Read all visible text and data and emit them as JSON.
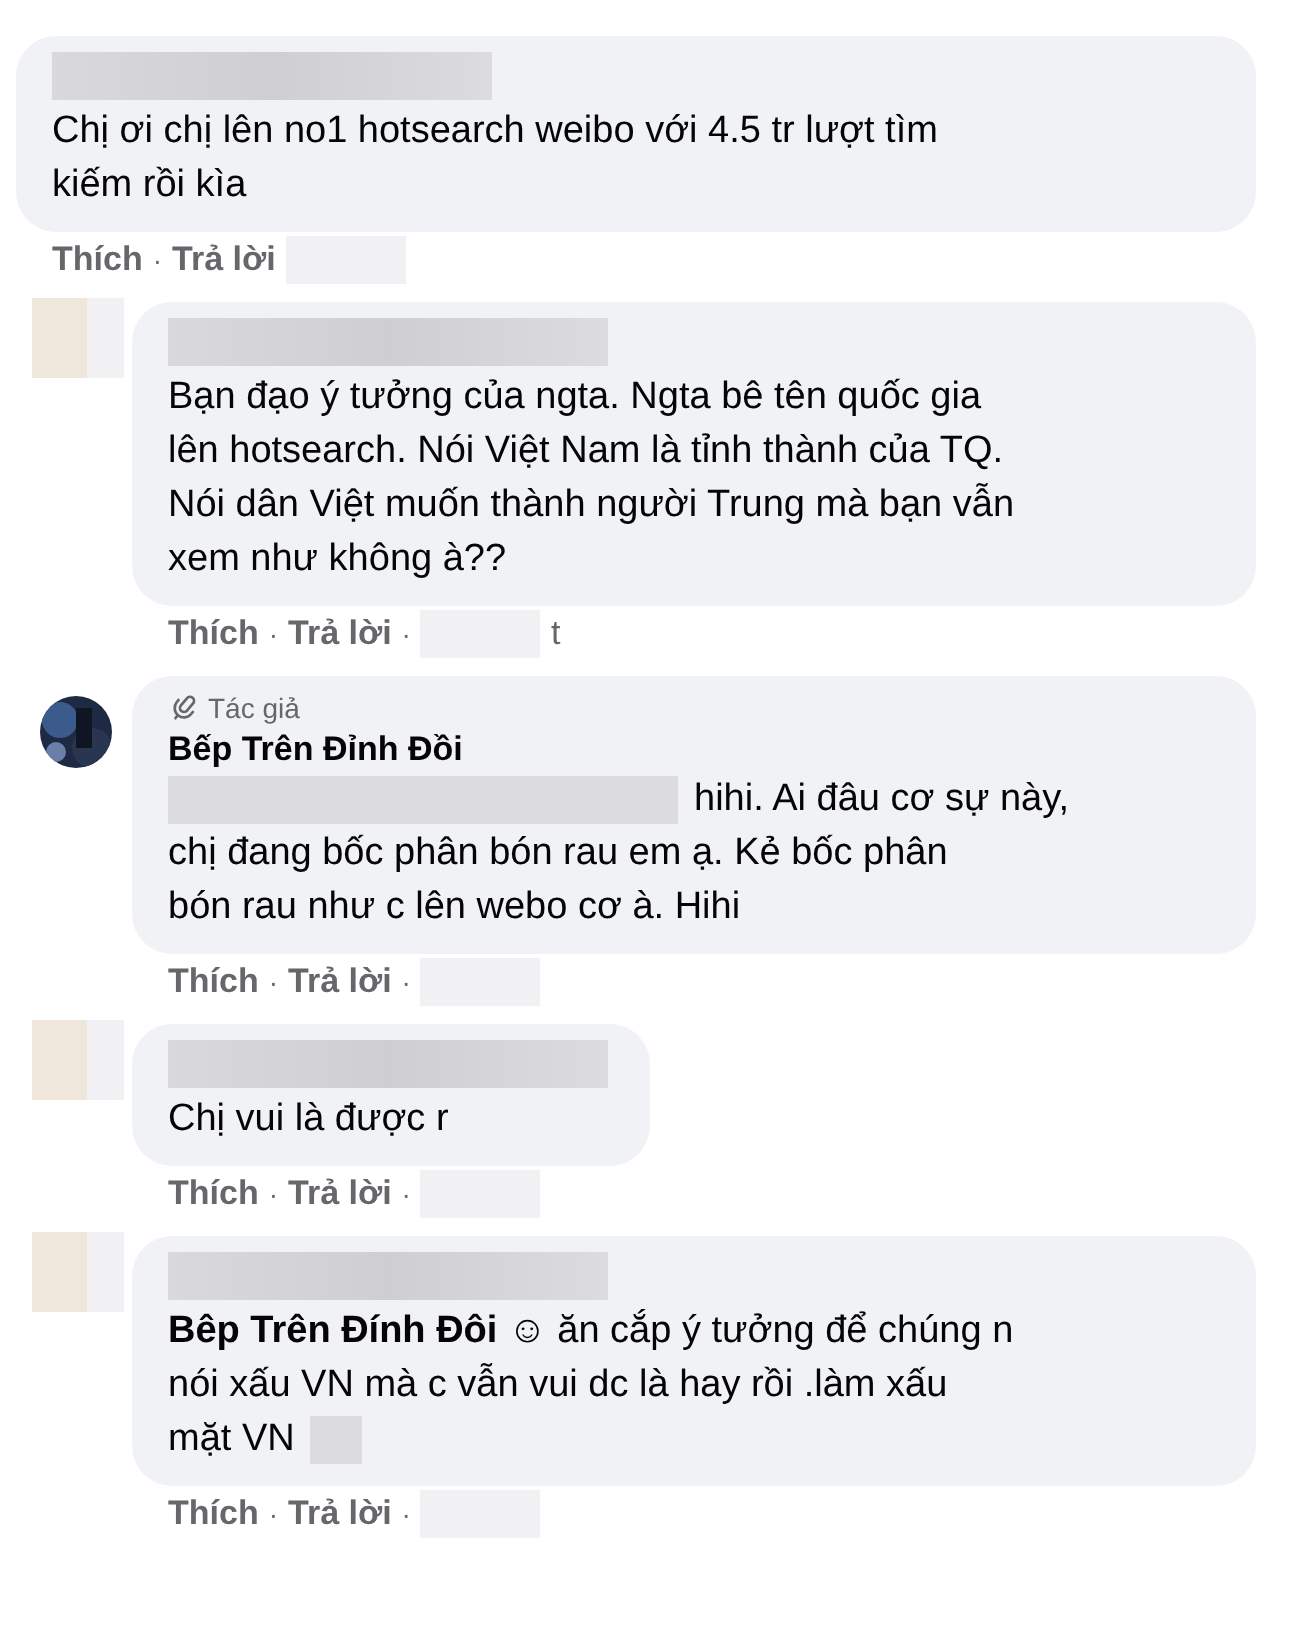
{
  "separator": "·",
  "comments": [
    {
      "kind": "top",
      "lines": [
        "Chị ơi chị lên no1 hotsearch weibo với 4.5 tr lượt tìm",
        "kiếm rồi kìa"
      ],
      "actions": [
        "Thích",
        "Trả lời"
      ]
    },
    {
      "kind": "reply",
      "lines": [
        "Bạn đạo ý tưởng của ngta. Ngta bê tên quốc gia",
        "lên hotsearch. Nói Việt Nam là tỉnh thành của TQ.",
        "Nói dân Việt muốn thành người Trung mà bạn vẫn",
        "xem như không à??"
      ],
      "actions": [
        "Thích",
        "Trả lời"
      ],
      "time_tail": "t"
    },
    {
      "kind": "author",
      "badge": "Tác giả",
      "author": "Bếp Trên Đỉnh Đồi",
      "first_line": "hihi. Ai đâu cơ sự này,",
      "lines": [
        "chị đang bốc phân bón rau em ạ. Kẻ bốc phân",
        "bón rau như c lên webo cơ à. Hihi"
      ],
      "actions": [
        "Thích",
        "Trả lời"
      ]
    },
    {
      "kind": "reply",
      "lines": [
        "Chị vui là được r"
      ],
      "actions": [
        "Thích",
        "Trả lời"
      ]
    },
    {
      "kind": "reply",
      "lines": [
        "**Bêp Trên Đính Đôi** ☺ ăn cắp ý tưởng để chúng n",
        "nói xấu VN mà c vẫn vui dc là hay rồi .làm xấu"
      ],
      "last_line": "mặt VN",
      "actions": [
        "Thích",
        "Trả lời"
      ]
    }
  ]
}
